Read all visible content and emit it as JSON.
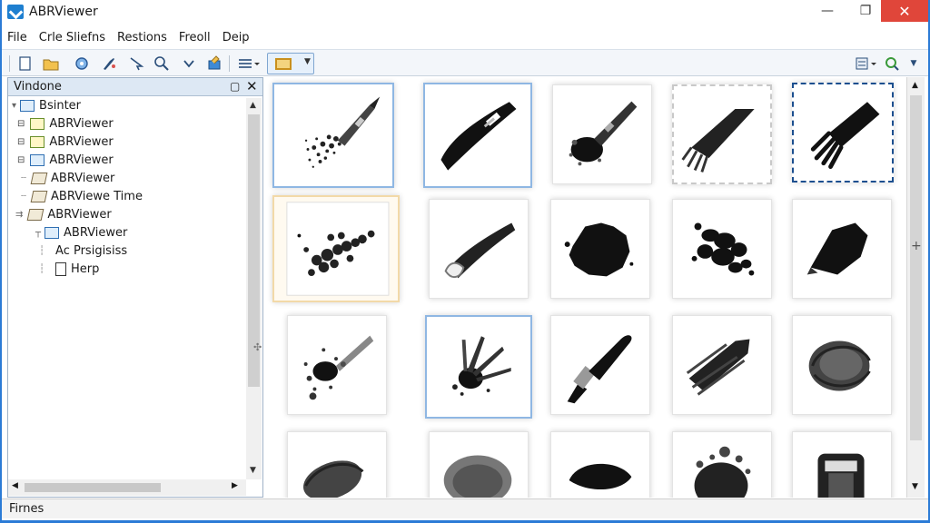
{
  "window": {
    "title": "ABRViewer",
    "minimize": "—",
    "maximize": "❐",
    "close": "✕"
  },
  "menu": [
    "File",
    "Crle Sliefns",
    "Restions",
    "Freoll",
    "Deip"
  ],
  "toolbar": {
    "icons": [
      "new-doc-icon",
      "open-folder-icon",
      "settings-icon",
      "brush-tool-icon",
      "cursor-icon",
      "search-icon",
      "down-arrow-icon",
      "paint-icon",
      "list-options-icon",
      "view-mode-dropdown",
      "layout-icon",
      "refresh-icon"
    ]
  },
  "left_panel": {
    "title": "Vindone",
    "restore": "▢",
    "close": "✕",
    "tree": [
      {
        "label": "Bsinter",
        "icon": "folder",
        "depth": 0
      },
      {
        "label": "ABRViewer",
        "icon": "folder-yellow",
        "depth": 1
      },
      {
        "label": "ABRViewer",
        "icon": "folder-yellow",
        "depth": 1
      },
      {
        "label": "ABRViewer",
        "icon": "folder",
        "depth": 1
      },
      {
        "label": "ABRViewer",
        "icon": "folder-open",
        "depth": 1
      },
      {
        "label": "ABRViewe Time",
        "icon": "folder-open",
        "depth": 1
      },
      {
        "label": "ABRViewer",
        "icon": "folder-open",
        "depth": 0
      },
      {
        "label": "ABRViewer",
        "icon": "folder",
        "depth": 2
      },
      {
        "label": "Ac Prsigisiss",
        "icon": "none",
        "depth": 2
      },
      {
        "label": "Herp",
        "icon": "doc",
        "depth": 2
      }
    ]
  },
  "brushes": [
    "hard-round-splatter",
    "flat-bristle",
    "round-soft",
    "bristle-fan",
    "fan-brush",
    "scatter-dots",
    "flat-soft",
    "ink-blot",
    "ink-splash",
    "charcoal-blot",
    "splatter-spray",
    "multi-brush",
    "round-pointed",
    "dry-streak",
    "swirl-soft",
    "round-swirl",
    "soft-round",
    "wet-smear",
    "sponge-dots",
    "cap-bottle"
  ],
  "status": {
    "text": "Firnes"
  }
}
